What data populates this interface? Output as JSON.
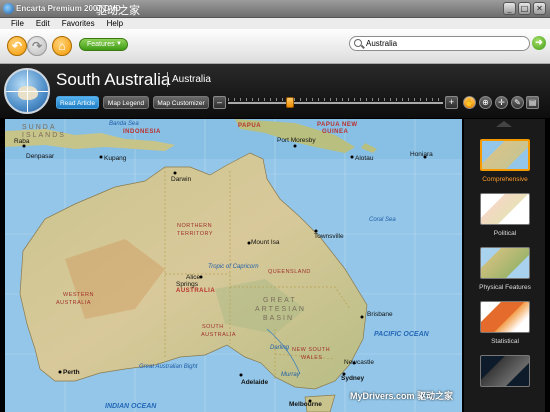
{
  "window": {
    "title": "Encarta Premium 2007 DVD",
    "watermark": "驱动之家",
    "controls": [
      "_",
      "□",
      "✕"
    ]
  },
  "menu": [
    "File",
    "Edit",
    "Favorites",
    "Help"
  ],
  "toolbar": {
    "back_icon": "back-arrow-icon",
    "forward_icon": "forward-arrow-icon",
    "home_icon": "home-icon",
    "features_label": "Features",
    "search_value": "Australia"
  },
  "header": {
    "title": "South Australia",
    "subtitle": "Australia",
    "tabs": [
      "Read Article",
      "Map Legend",
      "Map Customizer"
    ],
    "zoom_minus": "–",
    "zoom_plus": "+",
    "tools": [
      "hand-icon",
      "zoom-icon",
      "crosshair-icon",
      "pen-icon",
      "layers-icon"
    ]
  },
  "map": {
    "labels": [
      {
        "t": "SUNDA",
        "c": "big"
      },
      {
        "t": "ISLANDS",
        "c": "big"
      },
      {
        "t": "Banda Sea",
        "c": "water"
      },
      {
        "t": "INDONESIA",
        "c": "country"
      },
      {
        "t": "PAPUA",
        "c": "country"
      },
      {
        "t": "PAPUA NEW",
        "c": "country"
      },
      {
        "t": "GUINEA",
        "c": "country"
      },
      {
        "t": "Raba",
        "c": "city"
      },
      {
        "t": "Denpasar",
        "c": "city"
      },
      {
        "t": "Kupang",
        "c": "city"
      },
      {
        "t": "Port Moresby",
        "c": "city"
      },
      {
        "t": "Alotau",
        "c": "city"
      },
      {
        "t": "Honiara",
        "c": "city"
      },
      {
        "t": "Darwin",
        "c": "city"
      },
      {
        "t": "Coral Sea",
        "c": "water"
      },
      {
        "t": "Townsville",
        "c": "city"
      },
      {
        "t": "NORTHERN",
        "c": "region"
      },
      {
        "t": "TERRITORY",
        "c": "region"
      },
      {
        "t": "QUEENSLAND",
        "c": "region"
      },
      {
        "t": "Mount Isa",
        "c": "city"
      },
      {
        "t": "Tropic of Capricorn",
        "c": "water"
      },
      {
        "t": "Alice",
        "c": "city"
      },
      {
        "t": "Springs",
        "c": "city"
      },
      {
        "t": "AUSTRALIA",
        "c": "country"
      },
      {
        "t": "WESTERN",
        "c": "region"
      },
      {
        "t": "AUSTRALIA",
        "c": "region"
      },
      {
        "t": "GREAT",
        "c": "big"
      },
      {
        "t": "ARTESIAN",
        "c": "big"
      },
      {
        "t": "BASIN",
        "c": "big"
      },
      {
        "t": "Brisbane",
        "c": "city"
      },
      {
        "t": "SOUTH",
        "c": "region"
      },
      {
        "t": "AUSTRALIA",
        "c": "region"
      },
      {
        "t": "PACIFIC OCEAN",
        "c": "ocean"
      },
      {
        "t": "NEW SOUTH",
        "c": "region"
      },
      {
        "t": "WALES",
        "c": "region"
      },
      {
        "t": "Darling",
        "c": "water"
      },
      {
        "t": "Newcastle",
        "c": "city"
      },
      {
        "t": "Sydney",
        "c": "city"
      },
      {
        "t": "Perth",
        "c": "city"
      },
      {
        "t": "Great Australian Bight",
        "c": "water"
      },
      {
        "t": "Adelaide",
        "c": "city"
      },
      {
        "t": "Murray",
        "c": "water"
      },
      {
        "t": "Melbourne",
        "c": "city"
      },
      {
        "t": "INDIAN OCEAN",
        "c": "ocean"
      },
      {
        "t": "MyDrivers.com 驱动之家",
        "c": "watermark"
      }
    ]
  },
  "sidebar": {
    "items": [
      {
        "label": "Comprehensive",
        "active": true
      },
      {
        "label": "Political",
        "active": false
      },
      {
        "label": "Physical Features",
        "active": false
      },
      {
        "label": "Statistical",
        "active": false
      },
      {
        "label": "",
        "active": false
      }
    ]
  }
}
